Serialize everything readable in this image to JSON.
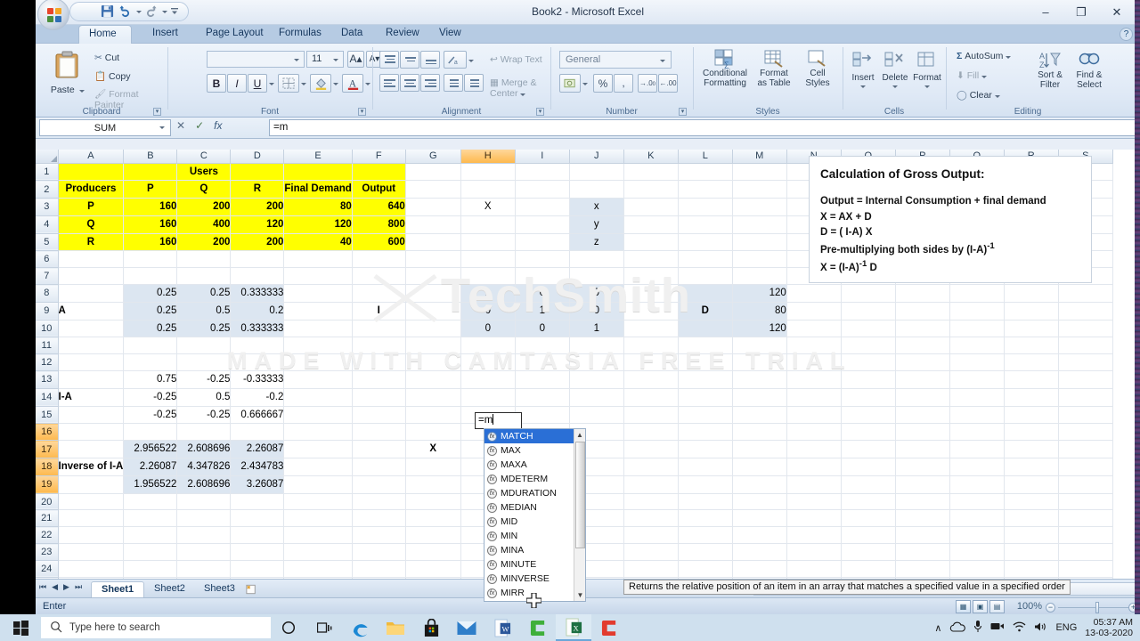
{
  "window": {
    "title": "Book2 - Microsoft Excel",
    "minimize": "–",
    "restore": "❐",
    "close": "✕",
    "help": "?"
  },
  "quick_access": {
    "save": "save-icon",
    "undo": "undo-icon",
    "redo": "redo-icon",
    "more": "more-icon"
  },
  "ribbon": {
    "tabs": [
      {
        "label": "Home",
        "active": true
      },
      {
        "label": "Insert",
        "active": false
      },
      {
        "label": "Page Layout",
        "active": false
      },
      {
        "label": "Formulas",
        "active": false
      },
      {
        "label": "Data",
        "active": false
      },
      {
        "label": "Review",
        "active": false
      },
      {
        "label": "View",
        "active": false
      }
    ],
    "groups": {
      "clipboard": {
        "label": "Clipboard",
        "paste": "Paste",
        "cut": "Cut",
        "copy": "Copy",
        "format_painter": "Format Painter"
      },
      "font": {
        "label": "Font",
        "font_name": "",
        "font_size": "11",
        "grow": "A",
        "shrink": "A",
        "bold": "B",
        "italic": "I",
        "underline": "U"
      },
      "alignment": {
        "label": "Alignment",
        "wrap_text": "Wrap Text",
        "merge_center": "Merge & Center"
      },
      "number": {
        "label": "Number",
        "format": "General",
        "percent": "%",
        "comma": ",",
        "inc_dec": ".00",
        "dec_dec": ".00"
      },
      "styles": {
        "label": "Styles",
        "conditional_formatting": "Conditional\nFormatting",
        "cf_line1": "Conditional",
        "cf_line2": "Formatting",
        "fat_line1": "Format",
        "fat_line2": "as Table",
        "cs_line1": "Cell",
        "cs_line2": "Styles"
      },
      "cells": {
        "label": "Cells",
        "insert": "Insert",
        "delete": "Delete",
        "format": "Format"
      },
      "editing": {
        "label": "Editing",
        "autosum": "AutoSum",
        "fill": "Fill",
        "clear": "Clear",
        "sort_filter_1": "Sort &",
        "sort_filter_2": "Filter",
        "find_select_1": "Find &",
        "find_select_2": "Select"
      }
    }
  },
  "formula_bar": {
    "name_box": "SUM",
    "cancel": "✕",
    "enter": "✓",
    "insert_function": "fx",
    "value": "=m"
  },
  "grid": {
    "columns": [
      "A",
      "B",
      "C",
      "D",
      "E",
      "F",
      "G",
      "H",
      "I",
      "J",
      "K",
      "L",
      "M",
      "N",
      "O",
      "P",
      "Q",
      "R",
      "S"
    ],
    "selected_column": "H",
    "selected_rows": [
      "16",
      "17",
      "18",
      "19"
    ],
    "rows": [
      {
        "n": "1",
        "cells": {
          "A": "",
          "B": "",
          "C": "Users",
          "D": "",
          "E": "",
          "F": ""
        }
      },
      {
        "n": "2",
        "cells": {
          "A": "Producers",
          "B": "P",
          "C": "Q",
          "D": "R",
          "E": "Final Demand",
          "F": "Output"
        }
      },
      {
        "n": "3",
        "cells": {
          "A": "P",
          "B": "160",
          "C": "200",
          "D": "200",
          "E": "80",
          "F": "640",
          "H": "X",
          "J": "x"
        }
      },
      {
        "n": "4",
        "cells": {
          "A": "Q",
          "B": "160",
          "C": "400",
          "D": "120",
          "E": "120",
          "F": "800",
          "J": "y"
        }
      },
      {
        "n": "5",
        "cells": {
          "A": "R",
          "B": "160",
          "C": "200",
          "D": "200",
          "E": "40",
          "F": "600",
          "J": "z"
        }
      },
      {
        "n": "6",
        "cells": {}
      },
      {
        "n": "7",
        "cells": {}
      },
      {
        "n": "8",
        "cells": {
          "B": "0.25",
          "C": "0.25",
          "D": "0.333333",
          "H": "1",
          "I": "0",
          "J": "0",
          "M": "120"
        }
      },
      {
        "n": "9",
        "cells": {
          "A": "A",
          "B": "0.25",
          "C": "0.5",
          "D": "0.2",
          "F": "I",
          "H": "0",
          "I": "1",
          "J": "0",
          "L": "D",
          "M": "80"
        }
      },
      {
        "n": "10",
        "cells": {
          "B": "0.25",
          "C": "0.25",
          "D": "0.333333",
          "H": "0",
          "I": "0",
          "J": "1",
          "M": "120"
        }
      },
      {
        "n": "11",
        "cells": {}
      },
      {
        "n": "12",
        "cells": {}
      },
      {
        "n": "13",
        "cells": {
          "B": "0.75",
          "C": "-0.25",
          "D": "-0.33333"
        }
      },
      {
        "n": "14",
        "cells": {
          "A": "I-A",
          "B": "-0.25",
          "C": "0.5",
          "D": "-0.2"
        }
      },
      {
        "n": "15",
        "cells": {
          "B": "-0.25",
          "C": "-0.25",
          "D": "0.666667"
        }
      },
      {
        "n": "16",
        "cells": {}
      },
      {
        "n": "17",
        "cells": {
          "B": "2.956522",
          "C": "2.608696",
          "D": "2.26087",
          "G": "X"
        }
      },
      {
        "n": "18",
        "cells": {
          "A": "Inverse of I-A",
          "B": "2.26087",
          "C": "4.347826",
          "D": "2.434783"
        }
      },
      {
        "n": "19",
        "cells": {
          "B": "1.956522",
          "C": "2.608696",
          "D": "3.26087"
        }
      },
      {
        "n": "20",
        "cells": {}
      },
      {
        "n": "21",
        "cells": {}
      },
      {
        "n": "22",
        "cells": {}
      },
      {
        "n": "23",
        "cells": {}
      },
      {
        "n": "24",
        "cells": {}
      },
      {
        "n": "25",
        "cells": {}
      }
    ]
  },
  "note_box": {
    "title": "Calculation of Gross Output:",
    "line1": "Output  = Internal Consumption + final demand",
    "line2": "X     =  AX +  D",
    "line3": "D     =  ( I-A) X",
    "line4": "Pre-multiplying both sides by (I-A)",
    "line4_sup": "-1",
    "line5": "X = (I-A)",
    "line5_sup": "-1",
    "line5_end": " D"
  },
  "cell_editor": {
    "value": "=m"
  },
  "autocomplete": {
    "items": [
      {
        "label": "MATCH",
        "selected": true
      },
      {
        "label": "MAX",
        "selected": false
      },
      {
        "label": "MAXA",
        "selected": false
      },
      {
        "label": "MDETERM",
        "selected": false
      },
      {
        "label": "MDURATION",
        "selected": false
      },
      {
        "label": "MEDIAN",
        "selected": false
      },
      {
        "label": "MID",
        "selected": false
      },
      {
        "label": "MIN",
        "selected": false
      },
      {
        "label": "MINA",
        "selected": false
      },
      {
        "label": "MINUTE",
        "selected": false
      },
      {
        "label": "MINVERSE",
        "selected": false
      },
      {
        "label": "MIRR",
        "selected": false
      }
    ],
    "scroll_up": "▲",
    "scroll_down": "▼"
  },
  "tooltip": {
    "text": "Returns the relative position of an item in an array that matches a specified value in a specified order"
  },
  "watermark": {
    "brand": "TechSmith",
    "tagline": "MADE WITH CAMTASIA FREE TRIAL"
  },
  "sheet_tabs": {
    "first": "⏮",
    "prev": "◀",
    "next": "▶",
    "last": "⏭",
    "tabs": [
      {
        "label": "Sheet1",
        "active": true
      },
      {
        "label": "Sheet2",
        "active": false
      },
      {
        "label": "Sheet3",
        "active": false
      }
    ],
    "insert_sheet": "insert-sheet-icon"
  },
  "status_bar": {
    "mode": "Enter",
    "view_normal": "normal-view-icon",
    "view_layout": "page-layout-view-icon",
    "view_break": "page-break-view-icon",
    "zoom": "100%",
    "zoom_out": "−",
    "zoom_in": "+"
  },
  "taskbar": {
    "start": "windows-start-icon",
    "search_placeholder": "Type here to search",
    "cortana": "cortana-icon",
    "task_view": "task-view-icon",
    "apps": [
      {
        "name": "edge-icon",
        "glyph": "e"
      },
      {
        "name": "file-explorer-icon",
        "glyph": ""
      },
      {
        "name": "microsoft-store-icon",
        "glyph": ""
      },
      {
        "name": "mail-icon",
        "glyph": ""
      },
      {
        "name": "word-icon",
        "glyph": "W"
      },
      {
        "name": "camtasia-studio-icon",
        "glyph": "C"
      },
      {
        "name": "excel-icon",
        "glyph": "X"
      },
      {
        "name": "camtasia-recorder-icon",
        "glyph": "C"
      }
    ],
    "tray": {
      "show_hidden": "∧",
      "onedrive": "onedrive-icon",
      "mic": "microphone-icon",
      "camera": "camera-icon",
      "network": "wifi-icon",
      "volume": "volume-icon",
      "language": "ENG",
      "time": "05:37 AM",
      "date": "13-03-2020"
    }
  },
  "colors": {
    "highlight_yellow": "#ffff00",
    "selection_blue": "#dce6f1",
    "accent_orange": "#fdb94e",
    "ribbon_blue": "#b6cbe3"
  }
}
